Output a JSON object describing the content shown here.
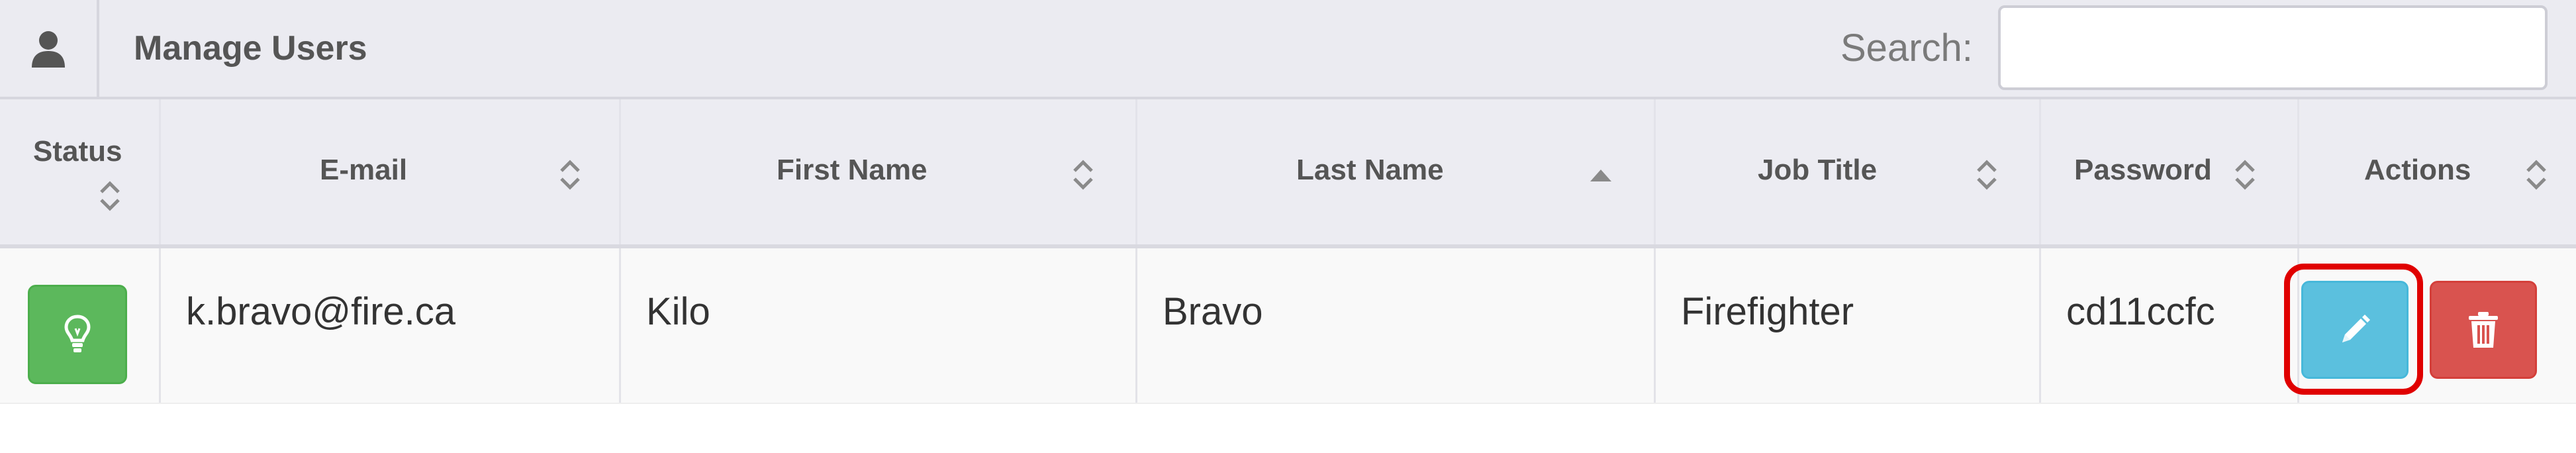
{
  "header": {
    "title": "Manage Users",
    "user_icon": "user-icon",
    "search_label": "Search:",
    "search_value": "",
    "search_placeholder": ""
  },
  "table": {
    "columns": [
      {
        "label": "Status",
        "sort": "unsorted"
      },
      {
        "label": "E-mail",
        "sort": "unsorted"
      },
      {
        "label": "First Name",
        "sort": "unsorted"
      },
      {
        "label": "Last Name",
        "sort": "ascending"
      },
      {
        "label": "Job Title",
        "sort": "unsorted"
      },
      {
        "label": "Password",
        "sort": "unsorted"
      },
      {
        "label": "Actions",
        "sort": "unsorted"
      }
    ],
    "rows": [
      {
        "status_icon": "lightbulb-icon",
        "email": "k.bravo@fire.ca",
        "first_name": "Kilo",
        "last_name": "Bravo",
        "job_title": "Firefighter",
        "password": "cd11ccfc",
        "actions": [
          {
            "icon": "pencil-icon",
            "color": "#5bc0de",
            "highlighted": true
          },
          {
            "icon": "trash-icon",
            "color": "#d9534f",
            "highlighted": false
          }
        ]
      }
    ]
  },
  "colors": {
    "header_bg": "#ebebf1",
    "status_green": "#5cb85c",
    "edit_blue": "#5bc0de",
    "delete_red": "#d9534f",
    "highlight_red": "#e00000"
  }
}
